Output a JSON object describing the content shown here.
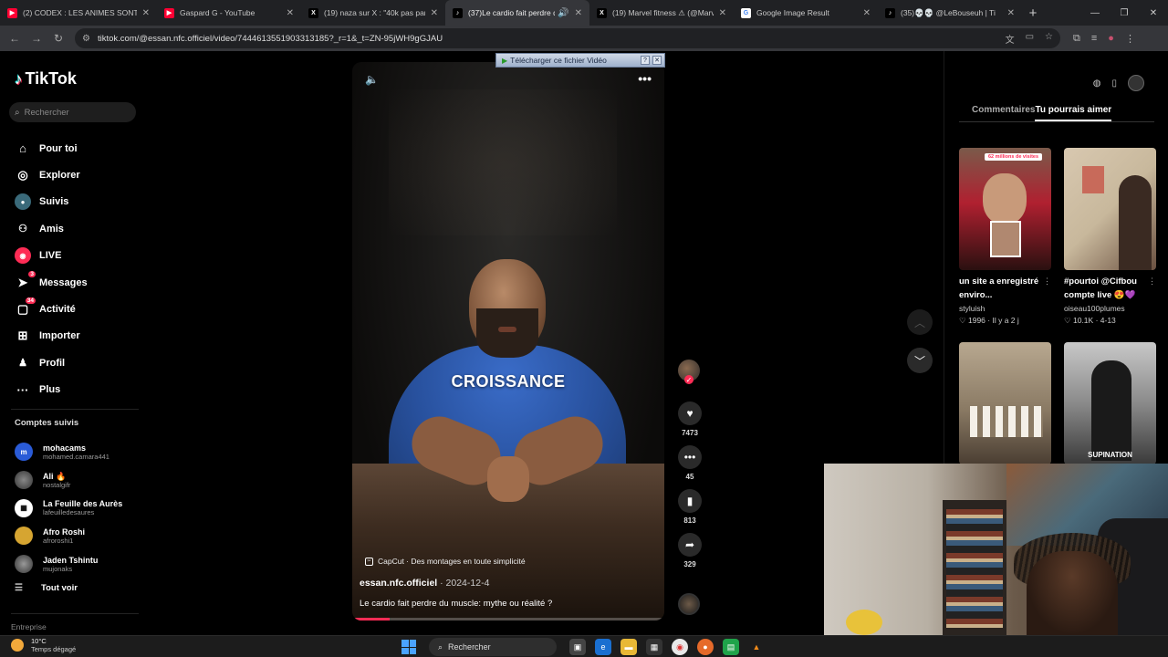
{
  "browser": {
    "tabs": [
      {
        "title": "(2) CODEX : LES ANIMES SONT",
        "favicon_color": "#ff0033",
        "favicon_glyph": "▶"
      },
      {
        "title": "Gaspard G - YouTube",
        "favicon_color": "#ff0033",
        "favicon_glyph": "▶"
      },
      {
        "title": "(19) naza sur X : \"40k pas par j",
        "favicon_color": "#000000",
        "favicon_glyph": "X"
      },
      {
        "title": "(37)Le cardio fait perdre du",
        "favicon_color": "#000000",
        "favicon_glyph": "♪"
      },
      {
        "title": "(19) Marvel fitness ⚠ (@Marve",
        "favicon_color": "#000000",
        "favicon_glyph": "X"
      },
      {
        "title": "Google Image Result",
        "favicon_color": "#ffffff",
        "favicon_glyph": "G"
      },
      {
        "title": "(35)💀💀 @LeBouseuh | Ti",
        "favicon_color": "#000000",
        "favicon_glyph": "♪"
      }
    ],
    "active_tab_index": 3,
    "url": "tiktok.com/@essan.nfc.officiel/video/7444613551903313185?_r=1&_t=ZN-95jWH9gGJAU"
  },
  "tiktok": {
    "logo": "TikTok",
    "search_placeholder": "Rechercher",
    "nav": [
      {
        "label": "Pour toi",
        "icon": "home-icon",
        "glyph": "⌂"
      },
      {
        "label": "Explorer",
        "icon": "compass-icon",
        "glyph": "◎"
      },
      {
        "label": "Suivis",
        "icon": "following-avatar-icon",
        "glyph": "●"
      },
      {
        "label": "Amis",
        "icon": "friends-icon",
        "glyph": "👥"
      },
      {
        "label": "LIVE",
        "icon": "live-icon",
        "glyph": "◉"
      },
      {
        "label": "Messages",
        "icon": "messages-icon",
        "glyph": "➤",
        "badge": "3"
      },
      {
        "label": "Activité",
        "icon": "activity-icon",
        "glyph": "▢",
        "badge": "34"
      },
      {
        "label": "Importer",
        "icon": "upload-icon",
        "glyph": "⊞"
      },
      {
        "label": "Profil",
        "icon": "profile-icon",
        "glyph": "👤"
      },
      {
        "label": "Plus",
        "icon": "more-icon",
        "glyph": "···"
      }
    ],
    "following_title": "Comptes suivis",
    "following": [
      {
        "name": "mohacams",
        "handle": "mohamed.camara441",
        "color": "#2a5bd7",
        "initial": "m"
      },
      {
        "name": "Ali 🔥",
        "handle": "nostalgifr",
        "color": "#555555",
        "initial": ""
      },
      {
        "name": "La Feuille des Aurès",
        "handle": "lafeuilledesaures",
        "color": "#ffffff",
        "initial": ""
      },
      {
        "name": "Afro Roshi",
        "handle": "afroroshi1",
        "color": "#d6a531",
        "initial": ""
      },
      {
        "name": "Jaden Tshintu",
        "handle": "mujonaks",
        "color": "#444444",
        "initial": ""
      }
    ],
    "see_all": "Tout voir",
    "footer_section": "Entreprise"
  },
  "video": {
    "download_bar": "Télécharger ce fichier Vidéo",
    "overlay_caption": "CROISSANCE",
    "capcut": "CapCut · Des montages en toute simplicité",
    "author": "essan.nfc.officiel",
    "date": " · 2024-12-4",
    "description": "Le cardio fait perdre du muscle: mythe ou réalité ?",
    "progress_percent": 12,
    "likes": "7473",
    "comments": "45",
    "saves": "813",
    "shares": "329"
  },
  "right_panel": {
    "tab_comments": "Commentaires",
    "tab_suggested": "Tu pourrais aimer",
    "cards": [
      {
        "title": "un site a enregistré enviro...",
        "author": "styluish",
        "likes": "1996",
        "age": "Il y a 2 j",
        "pill": "62 millions de visites",
        "overlay": ""
      },
      {
        "title": "#pourtoi @Cifbou compte live 😍💜",
        "author": "oiseau100plumes",
        "likes": "10.1K",
        "age": "4-13",
        "pill": "",
        "overlay": ""
      },
      {
        "title": "",
        "author": "",
        "likes": "",
        "age": "",
        "pill": "",
        "overlay": ""
      },
      {
        "title": "",
        "author": "",
        "likes": "",
        "age": "",
        "pill": "",
        "overlay": "SUPINATION"
      }
    ]
  },
  "taskbar": {
    "temperature": "10°C",
    "weather": "Temps dégagé",
    "search": "Rechercher"
  }
}
